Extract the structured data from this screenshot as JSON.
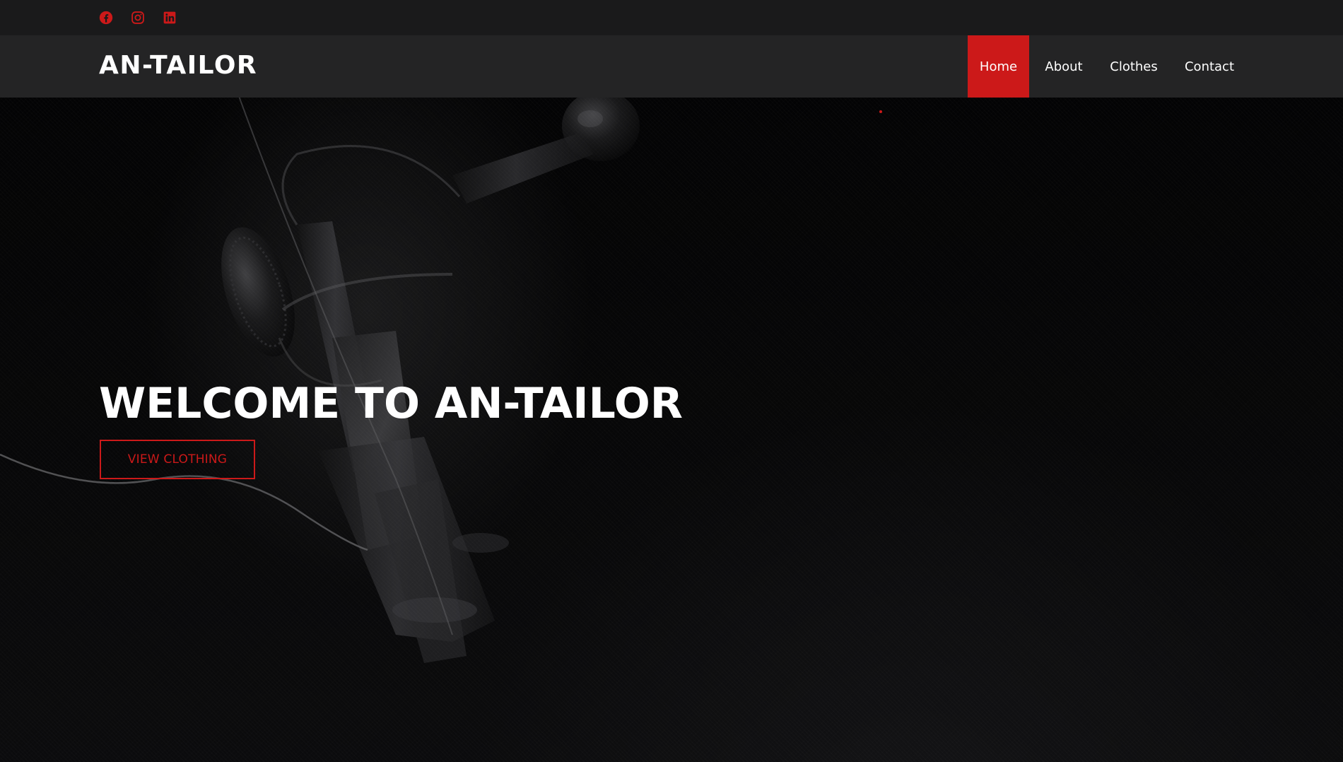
{
  "social": {
    "items": [
      {
        "icon": "facebook-icon"
      },
      {
        "icon": "instagram-icon"
      },
      {
        "icon": "linkedin-icon"
      }
    ]
  },
  "brand": {
    "name": "AN-TAILOR"
  },
  "nav": {
    "items": [
      {
        "label": "Home",
        "active": true
      },
      {
        "label": "About",
        "active": false
      },
      {
        "label": "Clothes",
        "active": false
      },
      {
        "label": "Contact",
        "active": false
      }
    ]
  },
  "hero": {
    "title": "WELCOME TO AN-TAILOR",
    "cta_label": "VIEW CLOTHING"
  },
  "colors": {
    "accent": "#cc1919",
    "topbar_bg": "#1a1a1b",
    "navbar_bg": "#242425",
    "text": "#ffffff"
  }
}
